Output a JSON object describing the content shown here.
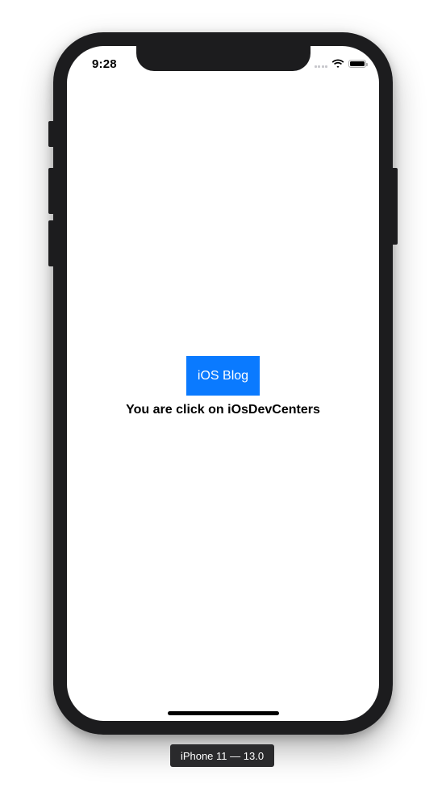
{
  "status_bar": {
    "time": "9:28",
    "icons": [
      "cellular-signal-icon",
      "wifi-icon",
      "battery-icon"
    ]
  },
  "main": {
    "button_label": "iOS Blog",
    "message": "You are click on iOsDevCenters"
  },
  "simulator": {
    "device_label": "iPhone 11 — 13.0"
  },
  "colors": {
    "button_background": "#0a7aff",
    "button_text": "#ffffff",
    "device_frame": "#1c1c1e",
    "screen_background": "#ffffff"
  }
}
